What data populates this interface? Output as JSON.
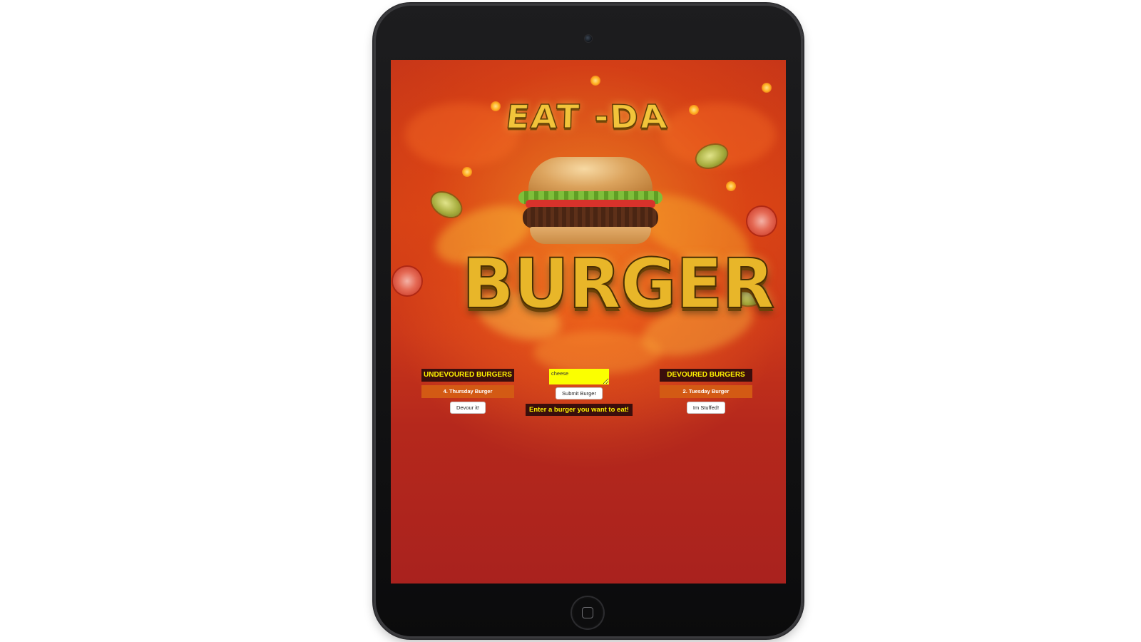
{
  "app": {
    "logo": {
      "top_word": "EAT -DA",
      "bottom_word": "BURGER"
    }
  },
  "undevoured": {
    "header": "UNDEVOURED BURGERS",
    "items": [
      {
        "label": "4. Thursday Burger",
        "button_label": "Devour it!"
      }
    ]
  },
  "form": {
    "input_value": "cheese",
    "submit_label": "Submit Burger",
    "hint": "Enter a burger you want to eat!"
  },
  "devoured": {
    "header": "DEVOURED BURGERS",
    "items": [
      {
        "label": "2. Tuesday Burger",
        "button_label": "Im Stuffed!"
      }
    ]
  },
  "colors": {
    "header_bg": "#3a0e0c",
    "header_text": "#fff200",
    "item_bg": "#d35a14",
    "input_bg": "#fbff00",
    "device_frame": "#111113"
  },
  "icons": {
    "camera": "front-camera-icon",
    "home": "home-button-icon"
  }
}
